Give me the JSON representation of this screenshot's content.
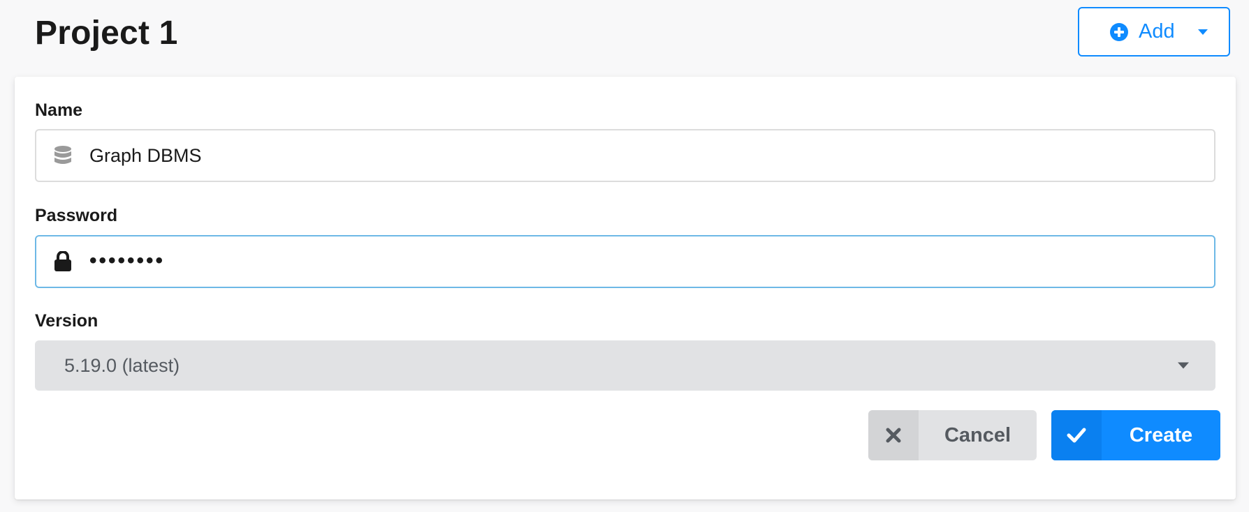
{
  "header": {
    "title": "Project 1",
    "add_button_label": "Add"
  },
  "form": {
    "name": {
      "label": "Name",
      "value": "Graph DBMS",
      "icon": "database-icon"
    },
    "password": {
      "label": "Password",
      "masked_value": "••••••••",
      "icon": "lock-icon"
    },
    "version": {
      "label": "Version",
      "selected": "5.19.0 (latest)"
    },
    "actions": {
      "cancel_label": "Cancel",
      "create_label": "Create"
    }
  },
  "colors": {
    "accent": "#0f8bff",
    "select_bg": "#e1e2e4",
    "focus_border": "#6db8e6"
  }
}
